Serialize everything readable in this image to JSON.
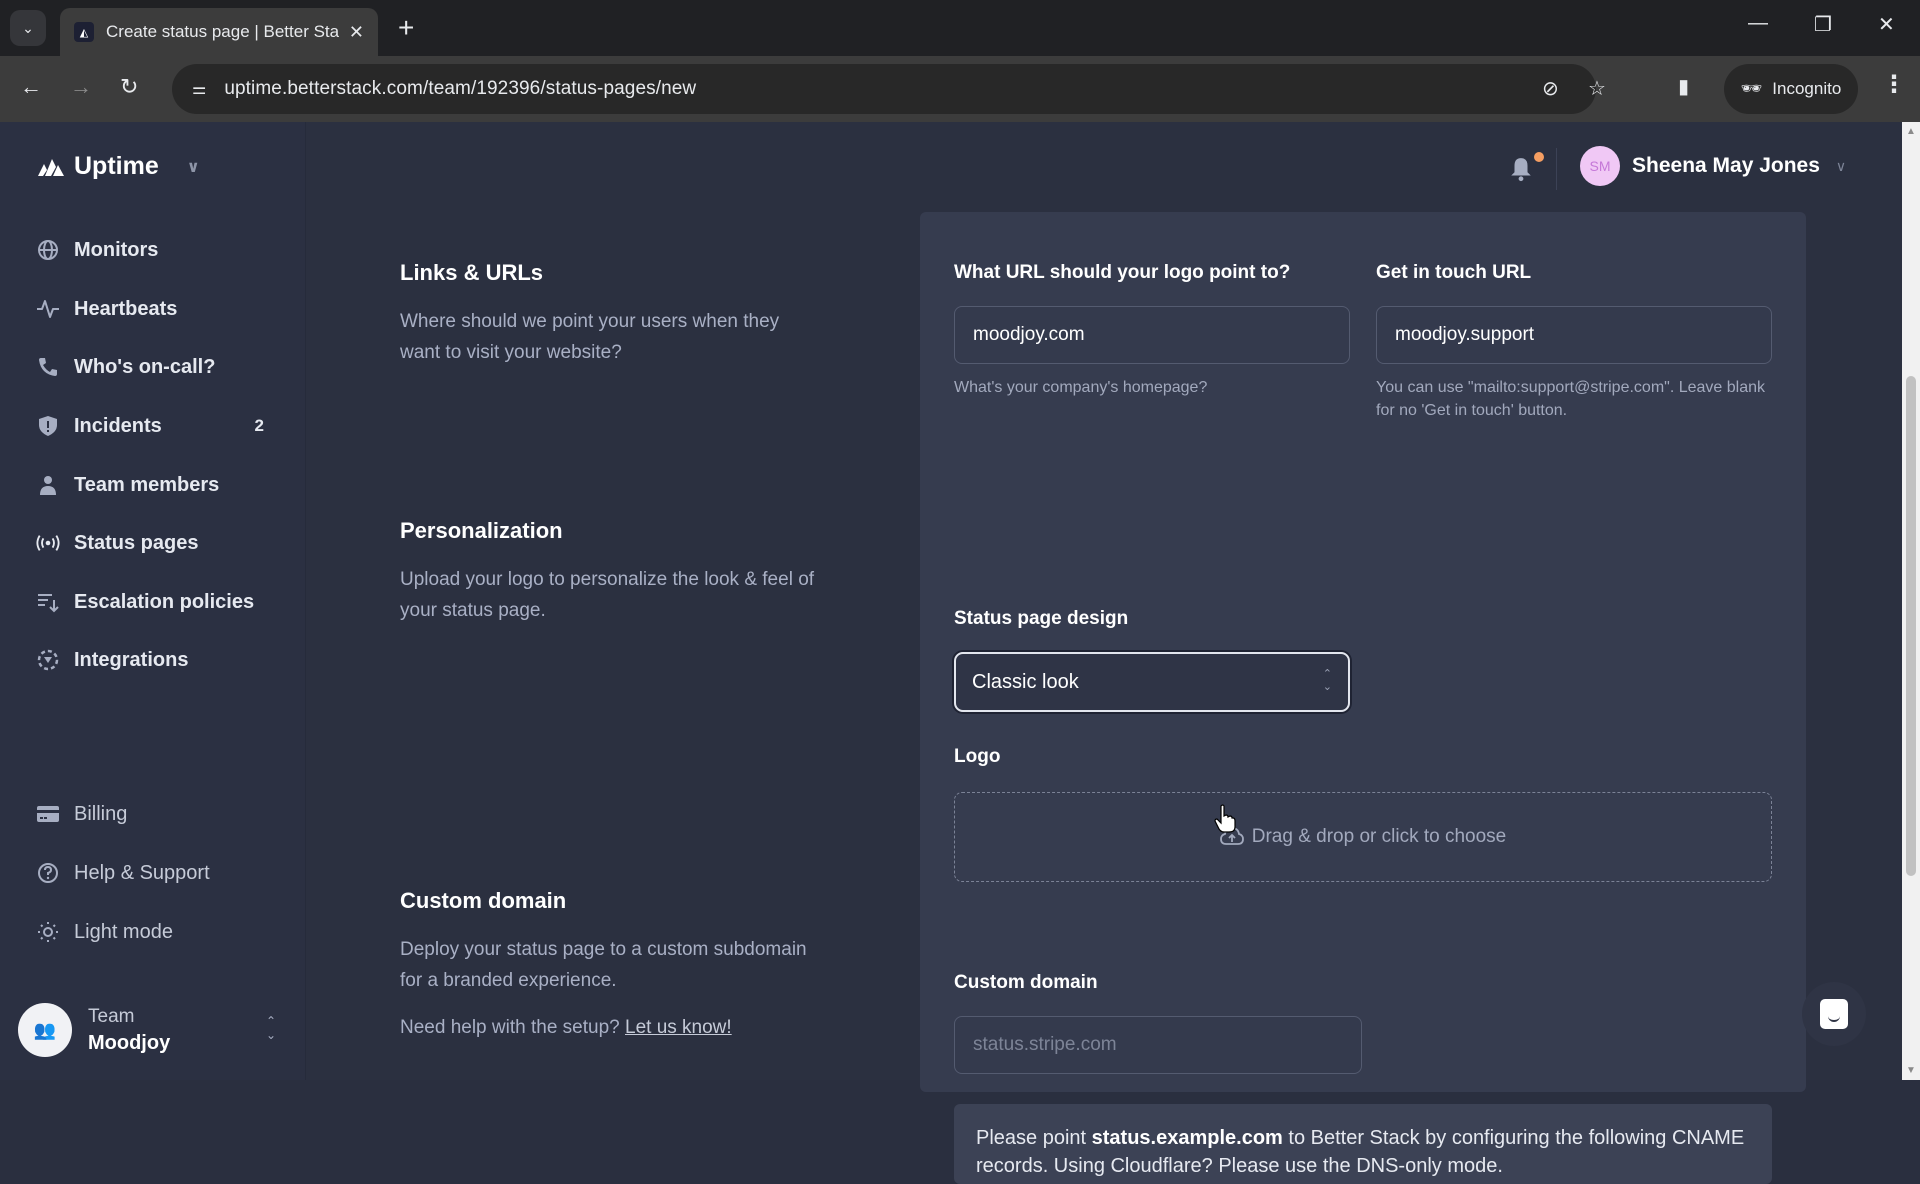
{
  "browser": {
    "tab_title": "Create status page | Better Stack",
    "url": "uptime.betterstack.com/team/192396/status-pages/new",
    "incognito_label": "Incognito"
  },
  "brand": {
    "name": "Uptime"
  },
  "sidebar": {
    "items": [
      {
        "label": "Monitors",
        "icon": "globe-icon"
      },
      {
        "label": "Heartbeats",
        "icon": "pulse-icon"
      },
      {
        "label": "Who's on-call?",
        "icon": "phone-icon"
      },
      {
        "label": "Incidents",
        "icon": "shield-alert-icon",
        "badge": "2"
      },
      {
        "label": "Team members",
        "icon": "person-icon"
      },
      {
        "label": "Status pages",
        "icon": "broadcast-icon"
      },
      {
        "label": "Escalation policies",
        "icon": "sort-list-icon"
      },
      {
        "label": "Integrations",
        "icon": "integrations-icon"
      }
    ],
    "bottom_items": [
      {
        "label": "Billing",
        "icon": "credit-card-icon"
      },
      {
        "label": "Help & Support",
        "icon": "help-circle-icon"
      },
      {
        "label": "Light mode",
        "icon": "sun-icon"
      }
    ],
    "team": {
      "label": "Team",
      "name": "Moodjoy"
    }
  },
  "header": {
    "user_initials": "SM",
    "user_name": "Sheena May Jones"
  },
  "sections": {
    "links": {
      "title": "Links & URLs",
      "description": "Where should we point your users when they want to visit your website?",
      "logo_url_label": "What URL should your logo point to?",
      "logo_url_value": "moodjoy.com",
      "logo_url_hint": "What's your company's homepage?",
      "contact_url_label": "Get in touch URL",
      "contact_url_value": "moodjoy.support",
      "contact_url_hint": "You can use \"mailto:support@stripe.com\". Leave blank for no 'Get in touch' button."
    },
    "personalization": {
      "title": "Personalization",
      "description": "Upload your logo to personalize the look & feel of your status page.",
      "design_label": "Status page design",
      "design_value": "Classic look",
      "logo_label": "Logo",
      "dropzone_text": "Drag & drop or click to choose"
    },
    "custom_domain": {
      "title": "Custom domain",
      "description": "Deploy your status page to a custom subdomain for a branded experience.",
      "help_prefix": "Need help with the setup?",
      "help_link": "Let us know!",
      "field_label": "Custom domain",
      "placeholder": "status.stripe.com",
      "notice_prefix": "Please point",
      "notice_domain": "status.example.com",
      "notice_suffix": "to Better Stack by configuring the following CNAME records. Using Cloudflare? Please use the DNS-only mode."
    }
  },
  "colors": {
    "app_bg": "#2b3040",
    "panel_bg": "#363c4f",
    "notification_dot": "#f59e62",
    "avatar_bg": "#f0c8f5"
  }
}
